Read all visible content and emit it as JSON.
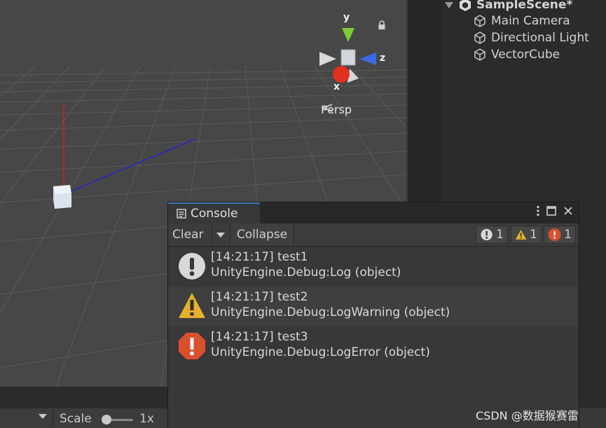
{
  "scene": {
    "view_label": "Persp",
    "axes": {
      "x": "x",
      "y": "y",
      "z": "z"
    },
    "colors": {
      "x_axis": "#e03a2a",
      "y_axis": "#8fcf3a",
      "z_axis": "#3a6fe0",
      "grid": "#5c5c5c",
      "background": "#474747"
    }
  },
  "scene_toolbar": {
    "scale_label": "Scale",
    "scale_value": "1x",
    "scale_level": 0.0
  },
  "hierarchy": {
    "scene_name": "SampleScene*",
    "items": [
      {
        "label": "Main Camera"
      },
      {
        "label": "Directional Light"
      },
      {
        "label": "VectorCube"
      }
    ]
  },
  "console": {
    "tab_label": "Console",
    "toolbar": {
      "clear_label": "Clear",
      "collapse_label": "Collapse",
      "log_count": "1",
      "warning_count": "1",
      "error_count": "1"
    },
    "entries": [
      {
        "type": "log",
        "line1": "[14:21:17] test1",
        "line2": "UnityEngine.Debug:Log (object)"
      },
      {
        "type": "warning",
        "line1": "[14:21:17] test2",
        "line2": "UnityEngine.Debug:LogWarning (object)"
      },
      {
        "type": "error",
        "line1": "[14:21:17] test3",
        "line2": "UnityEngine.Debug:LogError (object)"
      }
    ],
    "colors": {
      "tab_accent": "#3a79bb",
      "warning": "#e6b12a",
      "error": "#d9502f",
      "log": "#d8d8d8"
    }
  },
  "watermark": "CSDN @数据猴赛雷"
}
